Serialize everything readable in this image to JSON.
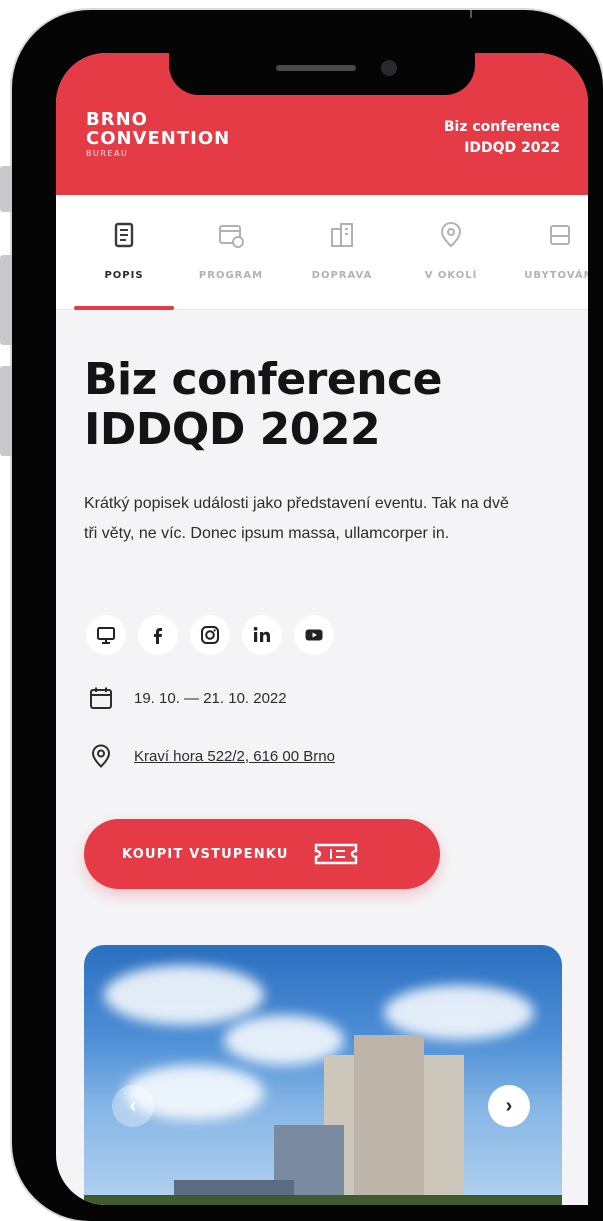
{
  "header": {
    "logo_line1": "BRNO",
    "logo_line2": "CONVENTION",
    "logo_line3": "BUREAU",
    "title_line1": "Biz conference",
    "title_line2": "IDDQD 2022",
    "background": "#e53b46"
  },
  "tabs": [
    {
      "label": "POPIS",
      "icon": "document-icon",
      "active": true
    },
    {
      "label": "PROGRAM",
      "icon": "calendar-clock-icon",
      "active": false
    },
    {
      "label": "DOPRAVA",
      "icon": "building-icon",
      "active": false
    },
    {
      "label": "V OKOLÍ",
      "icon": "map-pin-icon",
      "active": false
    },
    {
      "label": "UBYTOVÁNÍ",
      "icon": "bed-icon",
      "active": false
    }
  ],
  "event": {
    "title_line1": "Biz conference",
    "title_line2": "IDDQD 2022",
    "description": "Krátký popisek události jako představení eventu. Tak na dvě tři věty, ne víc. Donec ipsum massa, ullamcorper in.",
    "date": "19. 10. — 21. 10. 2022",
    "address": "Kraví hora 522/2, 616 00 Brno"
  },
  "socials": [
    {
      "icon": "web-icon"
    },
    {
      "icon": "facebook-icon"
    },
    {
      "icon": "instagram-icon"
    },
    {
      "icon": "linkedin-icon"
    },
    {
      "icon": "youtube-icon"
    }
  ],
  "cta": {
    "label": "KOUPIT VSTUPENKU",
    "icon": "ticket-icon"
  },
  "gallery": {
    "prev_icon": "chevron-left-icon",
    "next_icon": "chevron-right-icon"
  },
  "colors": {
    "accent": "#e53b46",
    "text": "#141416",
    "muted": "#b1b1b8"
  }
}
